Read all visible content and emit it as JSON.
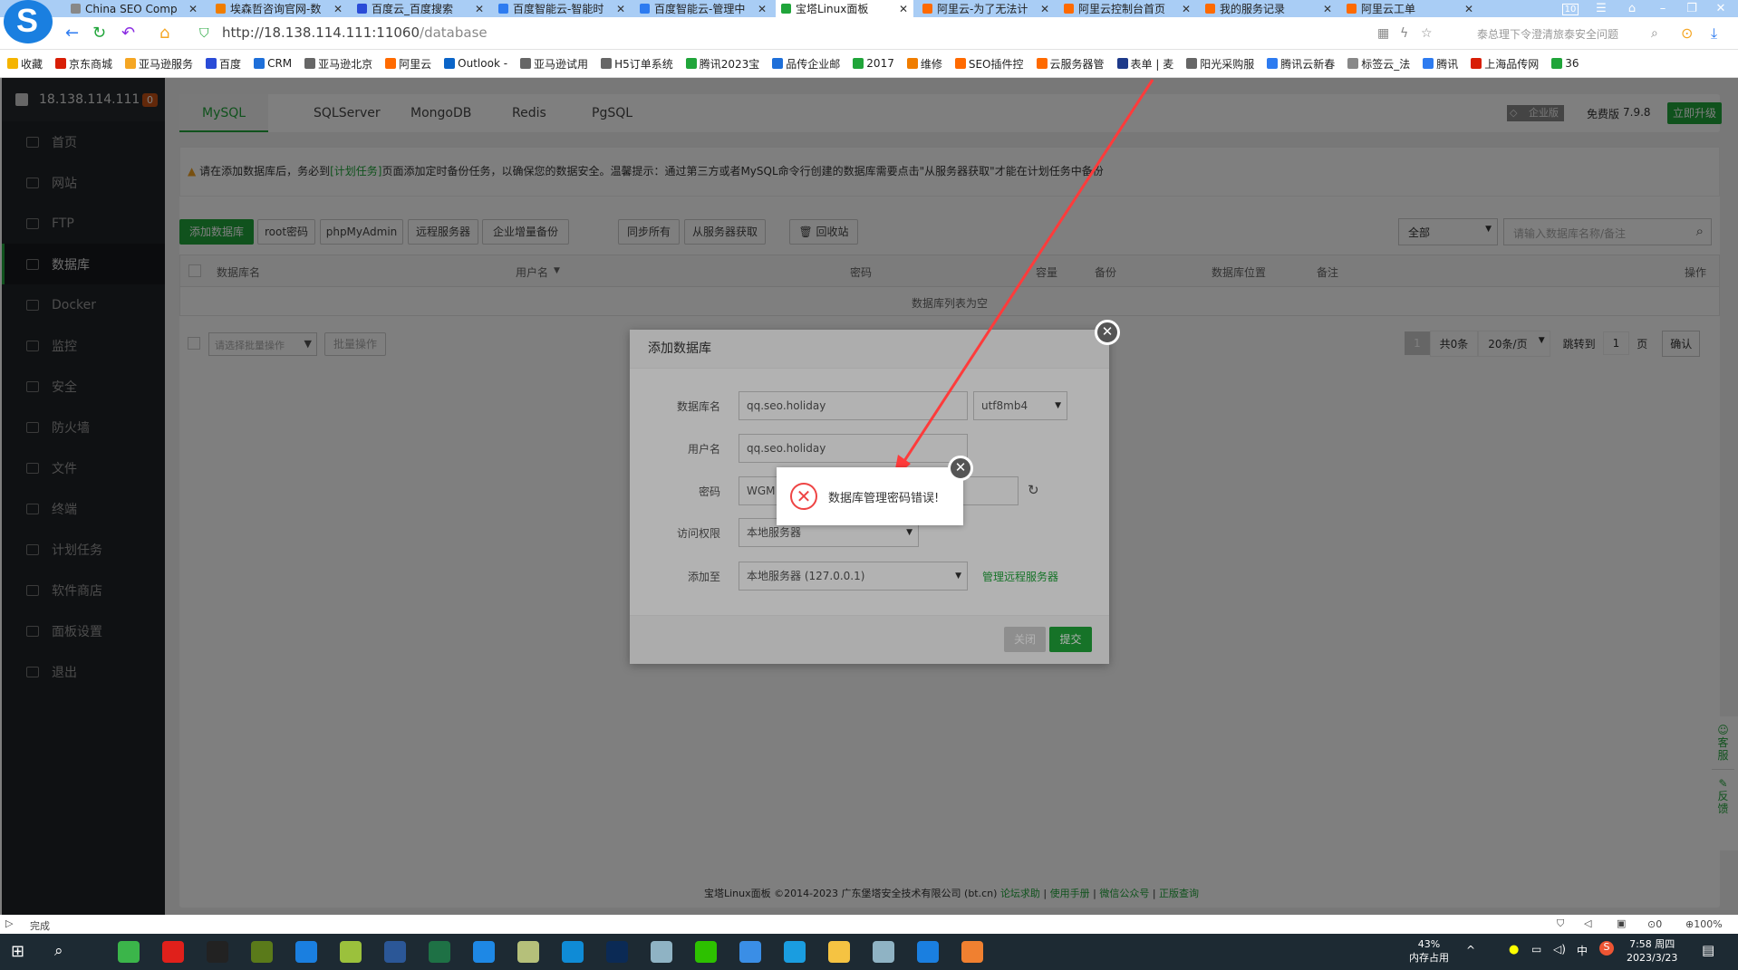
{
  "browser": {
    "tabs": [
      {
        "label": "China SEO Comp",
        "color": "#888"
      },
      {
        "label": "埃森哲咨询官网-数",
        "color": "#f07d00"
      },
      {
        "label": "百度云_百度搜索",
        "color": "#2a4bd7"
      },
      {
        "label": "百度智能云-智能时",
        "color": "#2d7bf0"
      },
      {
        "label": "百度智能云-管理中",
        "color": "#2d7bf0"
      },
      {
        "label": "宝塔Linux面板",
        "color": "#20a53a",
        "active": true
      },
      {
        "label": "阿里云-为了无法计",
        "color": "#ff6a00"
      },
      {
        "label": "阿里云控制台首页",
        "color": "#ff6a00"
      },
      {
        "label": "我的服务记录",
        "color": "#ff6a00"
      },
      {
        "label": "阿里云工单",
        "color": "#ff6a00"
      }
    ],
    "tab_count": "10",
    "url_host": "http://18.138.114.111:11060",
    "url_path": "/database",
    "search_hint": "泰总理下令澄清旅泰安全问题",
    "bookmarks": [
      {
        "label": "收藏",
        "color": "#f5b400"
      },
      {
        "label": "京东商城",
        "color": "#d81e06"
      },
      {
        "label": "亚马逊服务",
        "color": "#f5a623"
      },
      {
        "label": "百度",
        "color": "#2a4bd7"
      },
      {
        "label": "CRM",
        "color": "#1e6fd9"
      },
      {
        "label": "亚马逊北京",
        "color": "#666"
      },
      {
        "label": "阿里云",
        "color": "#ff6a00"
      },
      {
        "label": "Outlook -",
        "color": "#0a64c8"
      },
      {
        "label": "亚马逊试用",
        "color": "#666"
      },
      {
        "label": "H5订单系统",
        "color": "#666"
      },
      {
        "label": "腾讯2023宝",
        "color": "#20a53a"
      },
      {
        "label": "品传企业邮",
        "color": "#1e6fd9"
      },
      {
        "label": "2017",
        "color": "#20a53a"
      },
      {
        "label": "维修",
        "color": "#f07d00"
      },
      {
        "label": "SEO插件控",
        "color": "#ff6a00"
      },
      {
        "label": "云服务器管",
        "color": "#ff6a00"
      },
      {
        "label": "表单 | 麦",
        "color": "#1e3a8a"
      },
      {
        "label": "阳光采购服",
        "color": "#666"
      },
      {
        "label": "腾讯云新春",
        "color": "#2d7bf0"
      },
      {
        "label": "标签云_法",
        "color": "#888"
      },
      {
        "label": "腾讯",
        "color": "#2d7bf0"
      },
      {
        "label": "上海品传网",
        "color": "#d81e06"
      },
      {
        "label": "36",
        "color": "#20a53a"
      }
    ]
  },
  "sidebar": {
    "server": "18.138.114.111",
    "badge": "0",
    "items": [
      {
        "label": "首页"
      },
      {
        "label": "网站"
      },
      {
        "label": "FTP"
      },
      {
        "label": "数据库",
        "active": true
      },
      {
        "label": "Docker"
      },
      {
        "label": "监控"
      },
      {
        "label": "安全"
      },
      {
        "label": "防火墙"
      },
      {
        "label": "文件"
      },
      {
        "label": "终端"
      },
      {
        "label": "计划任务"
      },
      {
        "label": "软件商店"
      },
      {
        "label": "面板设置"
      },
      {
        "label": "退出"
      }
    ]
  },
  "main": {
    "db_tabs": [
      "MySQL",
      "SQLServer",
      "MongoDB",
      "Redis",
      "PgSQL"
    ],
    "edition": "企业版",
    "free": "免费版",
    "version": "7.9.8",
    "upgrade": "立即升级",
    "notice_pre": "请在添加数据库后，务必到",
    "notice_link": "[计划任务]",
    "notice_post": "页面添加定时备份任务，以确保您的数据安全。温馨提示：通过第三方或者MySQL命令行创建的数据库需要点击\"从服务器获取\"才能在计划任务中备份",
    "buttons": [
      "添加数据库",
      "root密码",
      "phpMyAdmin",
      "远程服务器",
      "企业增量备份"
    ],
    "buttons2": [
      "同步所有",
      "从服务器获取",
      "回收站"
    ],
    "filter": "全部",
    "search_placeholder": "请输入数据库名称/备注",
    "columns": [
      "数据库名",
      "用户名",
      "密码",
      "容量",
      "备份",
      "数据库位置",
      "备注",
      "操作"
    ],
    "empty": "数据库列表为空",
    "batch_placeholder": "请选择批量操作",
    "batch_btn": "批量操作",
    "page": "1",
    "total": "共0条",
    "per_page": "20条/页",
    "jump": "跳转到",
    "jump_val": "1",
    "page_unit": "页",
    "confirm": "确认",
    "footer": "宝塔Linux面板 ©2014-2023 广东堡塔安全技术有限公司 (bt.cn)",
    "footer_links": [
      "论坛求助",
      "使用手册",
      "微信公众号",
      "正版查询"
    ],
    "float": [
      "客服",
      "反馈"
    ]
  },
  "dialog": {
    "title": "添加数据库",
    "name_label": "数据库名",
    "name_value": "qq.seo.holiday",
    "charset": "utf8mb4",
    "user_label": "用户名",
    "user_value": "qq.seo.holiday",
    "pwd_label": "密码",
    "pwd_value": "WGM",
    "access_label": "访问权限",
    "access_value": "本地服务器",
    "addto_label": "添加至",
    "addto_value": "本地服务器 (127.0.0.1)",
    "manage_link": "管理远程服务器",
    "close": "关闭",
    "submit": "提交"
  },
  "error_msg": "数据库管理密码错误!",
  "status": {
    "text": "完成",
    "count": "0",
    "zoom": "100%"
  },
  "taskbar": {
    "mem": "43%",
    "mem_label": "内存占用",
    "ime": "中",
    "time": "7:58 周四",
    "date": "2023/3/23",
    "apps": [
      {
        "name": "360-browser",
        "color": "#3bb54a"
      },
      {
        "name": "acrobat",
        "color": "#e0201b"
      },
      {
        "name": "qq",
        "color": "#222"
      },
      {
        "name": "dreamweaver",
        "color": "#5a7a1a"
      },
      {
        "name": "sogou-browser",
        "color": "#1a7fe0"
      },
      {
        "name": "app",
        "color": "#9bc13c"
      },
      {
        "name": "word",
        "color": "#2b5797"
      },
      {
        "name": "excel",
        "color": "#1e7145"
      },
      {
        "name": "app-blue",
        "color": "#1e88e5"
      },
      {
        "name": "notes",
        "color": "#b5c07a"
      },
      {
        "name": "edge",
        "color": "#0f8bd6"
      },
      {
        "name": "photoshop",
        "color": "#0b2a55"
      },
      {
        "name": "app-glass",
        "color": "#8fb3c4"
      },
      {
        "name": "wechat",
        "color": "#2dc100"
      },
      {
        "name": "app-ring",
        "color": "#3a8ee6"
      },
      {
        "name": "search-app",
        "color": "#1a9de0"
      },
      {
        "name": "file-explorer",
        "color": "#f5c342"
      },
      {
        "name": "app-glass2",
        "color": "#8fb3c4"
      },
      {
        "name": "sogou-browser2",
        "color": "#1a7fe0"
      },
      {
        "name": "paint",
        "color": "#f08030"
      }
    ]
  }
}
